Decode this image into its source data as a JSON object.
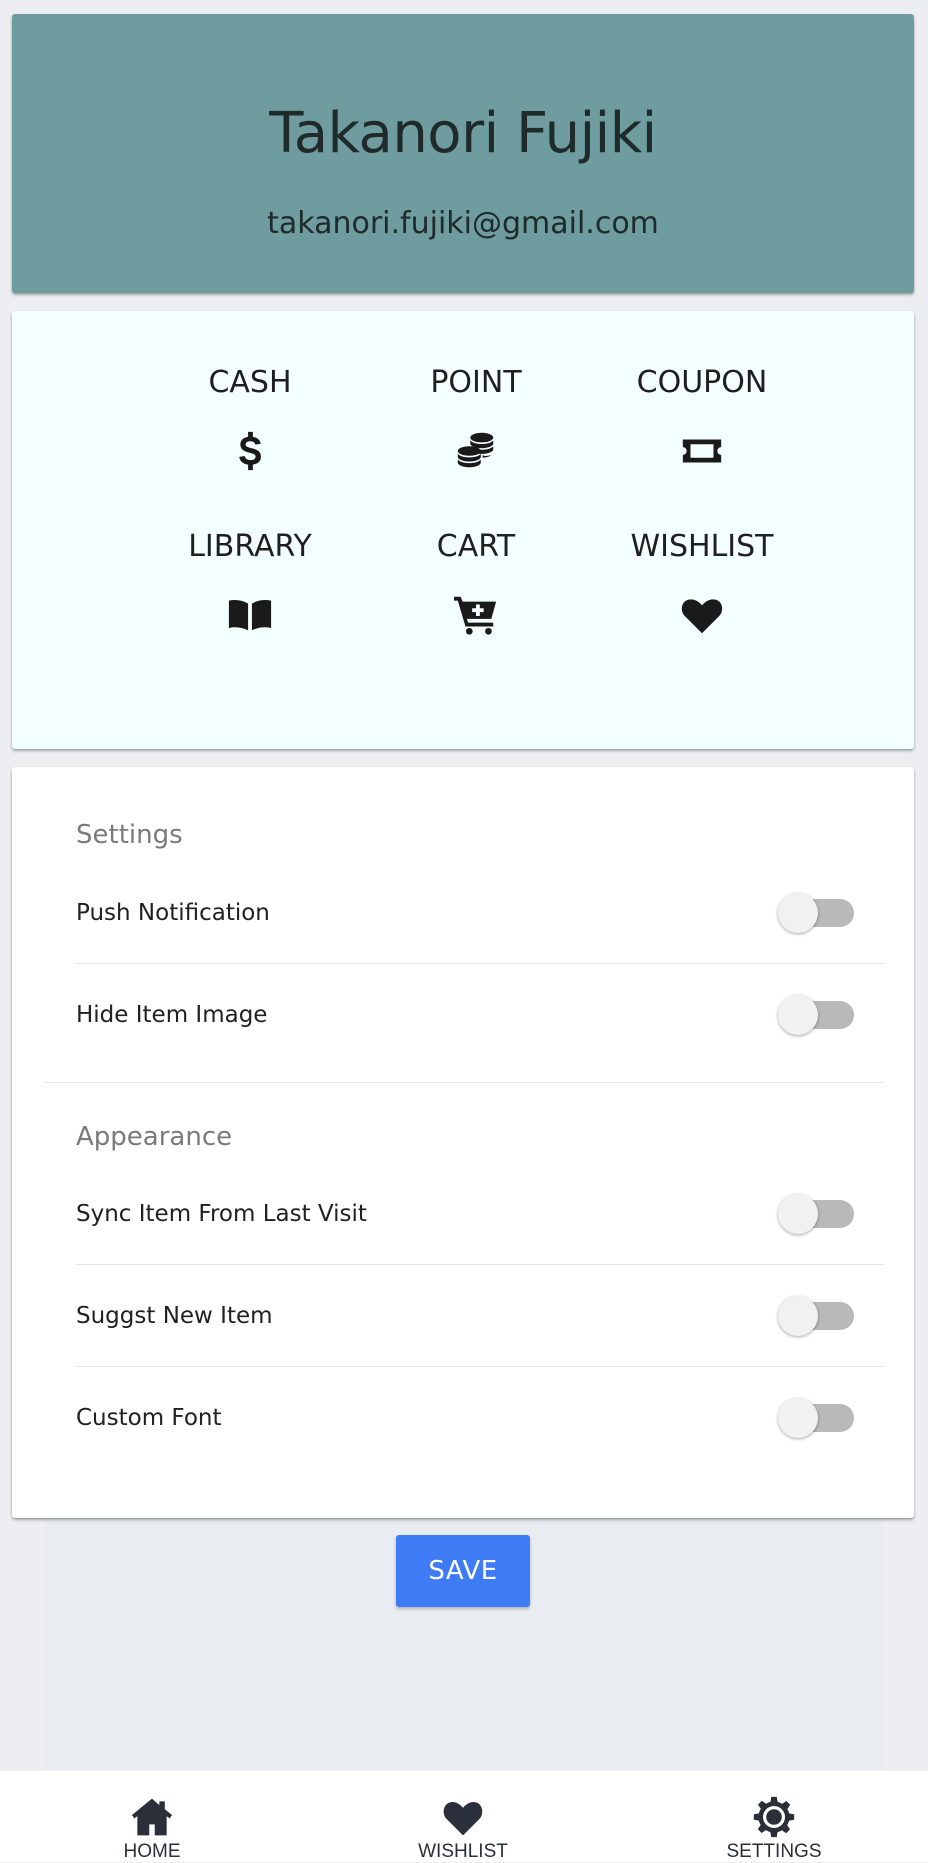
{
  "profile": {
    "name": "Takanori Fujiki",
    "email": "takanori.fujiki@gmail.com",
    "background_color": "#6f9c9e"
  },
  "menu": {
    "background_color": "#f2fffe",
    "items": [
      {
        "label": "CASH",
        "icon": "dollar-icon"
      },
      {
        "label": "POINT",
        "icon": "coins-icon"
      },
      {
        "label": "COUPON",
        "icon": "ticket-icon"
      },
      {
        "label": "LIBRARY",
        "icon": "book-open-icon"
      },
      {
        "label": "CART",
        "icon": "cart-plus-icon"
      },
      {
        "label": "WISHLIST",
        "icon": "heart-icon"
      }
    ]
  },
  "settings": {
    "settings_title": "Settings",
    "settings_items": [
      {
        "label": "Push Notification",
        "enabled": false
      },
      {
        "label": "Hide Item Image",
        "enabled": false
      }
    ],
    "appearance_title": "Appearance",
    "appearance_items": [
      {
        "label": "Sync Item From Last Visit",
        "enabled": false
      },
      {
        "label": "Suggst New Item",
        "enabled": false
      },
      {
        "label": "Custom Font",
        "enabled": false
      }
    ]
  },
  "save_button": {
    "label": "SAVE",
    "color": "#3f7bf5"
  },
  "bottom_nav": [
    {
      "label": "HOME",
      "icon": "home-icon"
    },
    {
      "label": "WISHLIST",
      "icon": "heart-icon"
    },
    {
      "label": "SETTINGS",
      "icon": "gear-icon"
    }
  ]
}
